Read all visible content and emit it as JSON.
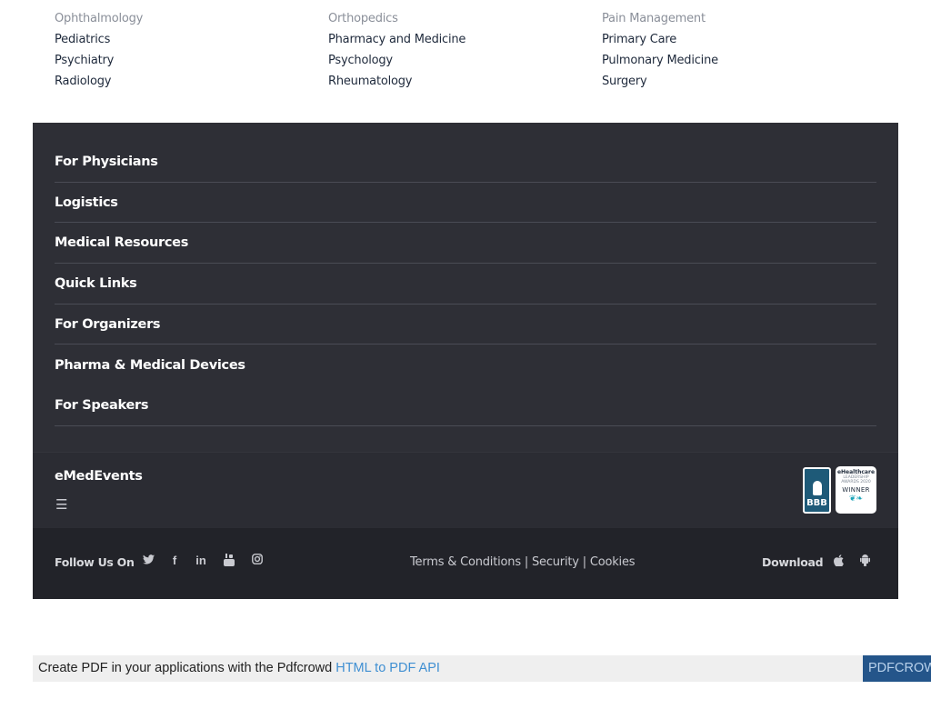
{
  "specialties": {
    "columns": [
      [
        "Ophthalmology",
        "Pediatrics",
        "Psychiatry",
        "Radiology"
      ],
      [
        "Orthopedics",
        "Pharmacy and Medicine",
        "Psychology",
        "Rheumatology"
      ],
      [
        "Pain Management",
        "Primary Care",
        "Pulmonary Medicine",
        "Surgery"
      ]
    ]
  },
  "accordion": {
    "items": [
      "For Physicians",
      "Logistics",
      "Medical Resources",
      "Quick Links",
      "For Organizers",
      "Pharma & Medical Devices",
      "For Speakers"
    ]
  },
  "brand": {
    "name": "eMedEvents",
    "menu_icon": "hamburger-icon",
    "bbb_text": "BBB",
    "award": {
      "line1": "eHealthcare",
      "line2": "LEADERSHIP AWARDS 2020",
      "line3": "WINNER"
    }
  },
  "footer": {
    "follow_label": "Follow Us On",
    "social_icons": [
      "twitter-icon",
      "facebook-icon",
      "linkedin-icon",
      "youtube-icon",
      "instagram-icon"
    ],
    "legal": {
      "terms": "Terms & Conditions",
      "security": "Security",
      "cookies": "Cookies",
      "separator": "|"
    },
    "download_label": "Download",
    "store_icons": [
      "apple-icon",
      "android-icon"
    ]
  },
  "pdf_banner": {
    "text": "Create PDF in your applications with the Pdfcrowd",
    "link": "HTML to PDF API",
    "button": "PDFCROWD"
  }
}
